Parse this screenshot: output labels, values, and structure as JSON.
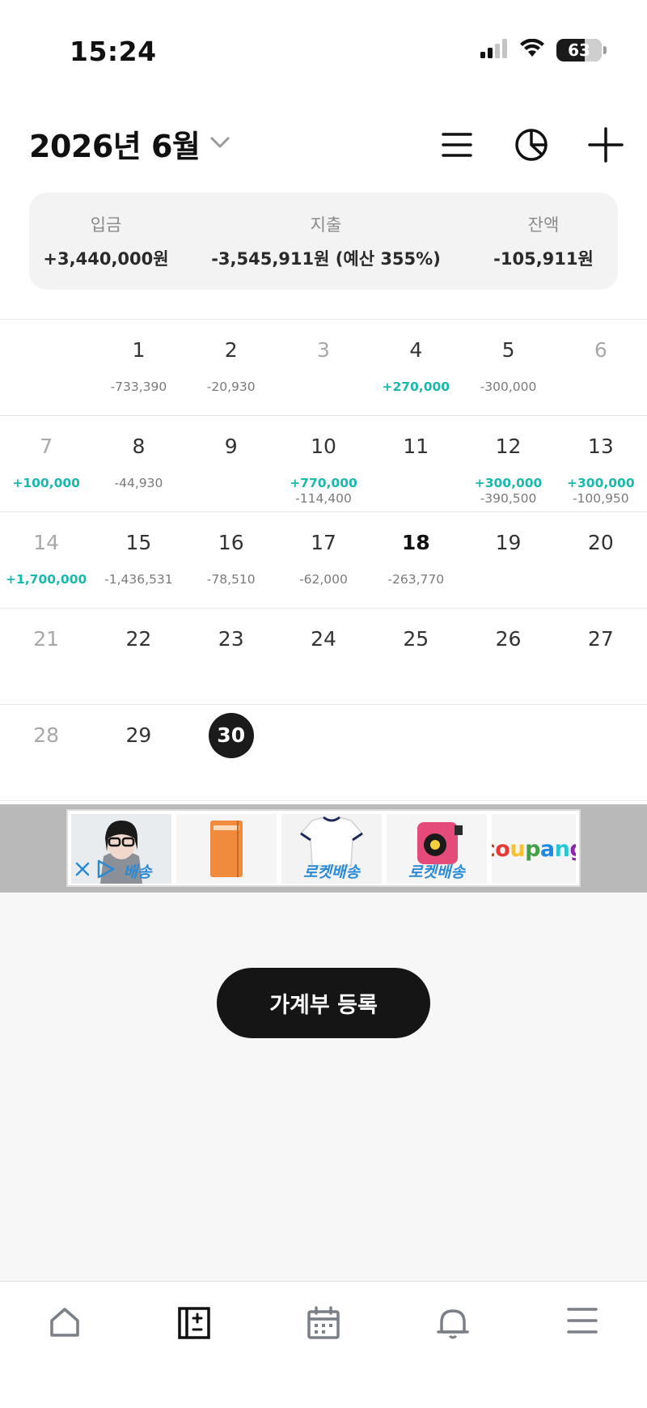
{
  "status_bar": {
    "time": "15:24",
    "battery": "63",
    "battery_level": 0.63,
    "icons": [
      "signal-icon",
      "wifi-icon",
      "battery-icon"
    ]
  },
  "header": {
    "month": "2026년 6월",
    "actions": [
      "list-icon",
      "pie-chart-icon",
      "plus-icon"
    ]
  },
  "summary": {
    "income_label": "입금",
    "income_value": "+3,440,000원",
    "expense_label": "지출",
    "expense_value": "-3,545,911원 (예산 355%)",
    "balance_label": "잔액",
    "balance_value": "-105,911원"
  },
  "calendar": {
    "weeks": [
      [
        {
          "day": "",
          "style": "normal",
          "income": "",
          "expense": ""
        },
        {
          "day": "1",
          "style": "normal",
          "income": "",
          "expense": "-733,390"
        },
        {
          "day": "2",
          "style": "normal",
          "income": "",
          "expense": "-20,930"
        },
        {
          "day": "3",
          "style": "muted",
          "income": "",
          "expense": ""
        },
        {
          "day": "4",
          "style": "normal",
          "income": "+270,000",
          "expense": ""
        },
        {
          "day": "5",
          "style": "normal",
          "income": "",
          "expense": "-300,000"
        },
        {
          "day": "6",
          "style": "muted",
          "income": "",
          "expense": ""
        }
      ],
      [
        {
          "day": "7",
          "style": "muted",
          "income": "+100,000",
          "expense": ""
        },
        {
          "day": "8",
          "style": "normal",
          "income": "",
          "expense": "-44,930"
        },
        {
          "day": "9",
          "style": "normal",
          "income": "",
          "expense": ""
        },
        {
          "day": "10",
          "style": "normal",
          "income": "+770,000",
          "expense": "-114,400"
        },
        {
          "day": "11",
          "style": "normal",
          "income": "",
          "expense": ""
        },
        {
          "day": "12",
          "style": "normal",
          "income": "+300,000",
          "expense": "-390,500"
        },
        {
          "day": "13",
          "style": "normal",
          "income": "+300,000",
          "expense": "-100,950"
        }
      ],
      [
        {
          "day": "14",
          "style": "muted",
          "income": "+1,700,000",
          "expense": ""
        },
        {
          "day": "15",
          "style": "normal",
          "income": "",
          "expense": "-1,436,531"
        },
        {
          "day": "16",
          "style": "normal",
          "income": "",
          "expense": "-78,510"
        },
        {
          "day": "17",
          "style": "normal",
          "income": "",
          "expense": "-62,000"
        },
        {
          "day": "18",
          "style": "bold",
          "income": "",
          "expense": "-263,770"
        },
        {
          "day": "19",
          "style": "normal",
          "income": "",
          "expense": ""
        },
        {
          "day": "20",
          "style": "normal",
          "income": "",
          "expense": ""
        }
      ],
      [
        {
          "day": "21",
          "style": "muted",
          "income": "",
          "expense": ""
        },
        {
          "day": "22",
          "style": "normal",
          "income": "",
          "expense": ""
        },
        {
          "day": "23",
          "style": "normal",
          "income": "",
          "expense": ""
        },
        {
          "day": "24",
          "style": "normal",
          "income": "",
          "expense": ""
        },
        {
          "day": "25",
          "style": "normal",
          "income": "",
          "expense": ""
        },
        {
          "day": "26",
          "style": "normal",
          "income": "",
          "expense": ""
        },
        {
          "day": "27",
          "style": "normal",
          "income": "",
          "expense": ""
        }
      ],
      [
        {
          "day": "28",
          "style": "muted",
          "income": "",
          "expense": ""
        },
        {
          "day": "29",
          "style": "normal",
          "income": "",
          "expense": ""
        },
        {
          "day": "30",
          "style": "selected",
          "income": "",
          "expense": ""
        },
        {
          "day": "",
          "style": "normal",
          "income": "",
          "expense": ""
        },
        {
          "day": "",
          "style": "normal",
          "income": "",
          "expense": ""
        },
        {
          "day": "",
          "style": "normal",
          "income": "",
          "expense": ""
        },
        {
          "day": "",
          "style": "normal",
          "income": "",
          "expense": ""
        }
      ]
    ]
  },
  "ad": {
    "items": [
      {
        "badge": "배송",
        "name": "ad-product-glasses"
      },
      {
        "badge": "",
        "name": "ad-product-notebook"
      },
      {
        "badge": "로켓배송",
        "name": "ad-product-tshirt"
      },
      {
        "badge": "로켓배송",
        "name": "ad-product-tape"
      }
    ],
    "logo_text": "coupang",
    "logo_colors": [
      "#a0522d",
      "#e53935",
      "#fbc02d",
      "#43a047",
      "#1e88e5",
      "#26c6da",
      "#8e24aa"
    ]
  },
  "register_button": "가계부 등록",
  "colors": {
    "income": "#19b9ac",
    "expense": "#7a7a7a",
    "accent_dark": "#151515"
  },
  "bottom_nav": [
    "home-icon",
    "ledger-icon",
    "calendar-icon",
    "bell-icon",
    "menu-icon"
  ]
}
